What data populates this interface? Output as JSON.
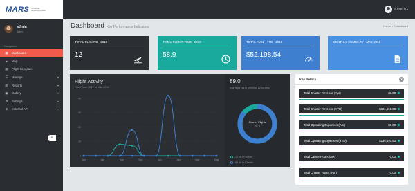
{
  "brand": {
    "logo": "MARS",
    "tagline": "Mil Aircraft Reporting System"
  },
  "user": {
    "name": "admin",
    "role": "John"
  },
  "nav": {
    "heading": "Navigation",
    "items": [
      {
        "label": "Dashboard",
        "icon": "dashboard-icon",
        "active": true,
        "submenu": false
      },
      {
        "label": "Map",
        "icon": "map-icon",
        "active": false,
        "submenu": false
      },
      {
        "label": "Flight Schedule",
        "icon": "calendar-icon",
        "active": false,
        "submenu": false
      },
      {
        "label": "Manage",
        "icon": "list-icon",
        "active": false,
        "submenu": true
      },
      {
        "label": "Reports",
        "icon": "report-icon",
        "active": false,
        "submenu": true
      },
      {
        "label": "Gallery",
        "icon": "gallery-icon",
        "active": false,
        "submenu": true
      },
      {
        "label": "Settings",
        "icon": "gear-icon",
        "active": false,
        "submenu": true
      },
      {
        "label": "External API",
        "icon": "api-icon",
        "active": false,
        "submenu": true
      }
    ],
    "collapse": "«"
  },
  "topbar": {
    "user_label": "NASBLP ▾"
  },
  "page": {
    "title": "Dashboard",
    "subtitle": "Key Performance Indicators"
  },
  "breadcrumb": {
    "home": "Home",
    "sep": "/",
    "current": "Dashboard"
  },
  "stats": [
    {
      "title": "TOTAL FLIGHTS - 2018",
      "value": "12",
      "icon": "airplane-icon",
      "color": "#2b2e33"
    },
    {
      "title": "TOTAL FLIGHT TIME - 2018",
      "value": "58.9",
      "icon": "clock-icon",
      "color": "#1aa99d"
    },
    {
      "title": "TOTAL FUEL - YTD - 2018",
      "value": "$52,198.54",
      "icon": "gauge-icon",
      "color": "#3f7fcf"
    },
    {
      "title": "MONTHLY SUMMARY - May, 2018",
      "value": "",
      "icon": "document-icon",
      "color": "#4a90e2"
    }
  ],
  "activity": {
    "title": "Flight Activity",
    "subtitle": "From June 2017 to May 2018"
  },
  "chart_data": {
    "type": "line",
    "x": [
      "Jun",
      "Jul",
      "Aug",
      "Sep",
      "Oct",
      "Nov",
      "Dec",
      "Jan",
      "Feb",
      "Mar",
      "Apr",
      "May"
    ],
    "x_tick_labels": [
      "Jun",
      "Jan",
      "Mar",
      "Sep",
      "Jan",
      "Jan",
      "Mar",
      "May"
    ],
    "ylim": [
      0,
      40
    ],
    "y_ticks": [
      0,
      10,
      20,
      30,
      40
    ],
    "series": [
      {
        "values": [
          0,
          0,
          0,
          0,
          18,
          0,
          0,
          0,
          0,
          0,
          0,
          0
        ],
        "color": "#3f7fcf"
      },
      {
        "values": [
          0,
          0,
          0,
          8,
          7,
          0,
          0,
          0,
          0,
          0,
          0,
          0
        ],
        "color": "#1aa99d"
      },
      {
        "values": [
          0,
          0,
          0,
          0,
          0,
          0,
          0,
          42,
          0,
          0,
          0,
          0
        ],
        "color": "#3f7fcf"
      }
    ]
  },
  "summary": {
    "value": "89.0",
    "subtitle": "total flight hrs in previous 12 months",
    "donut_label": "Charter Flights",
    "donut_value": "76.9",
    "donut_fraction": 0.86,
    "legend": [
      {
        "label": "12.08 hr Owner",
        "color": "#1aa99d"
      },
      {
        "label": "85.48 hr Charter",
        "color": "#3f7fcf"
      }
    ]
  },
  "metrics": {
    "title": "Key Metrics",
    "rows": [
      {
        "label": "Total Charter Revenue (Apr)",
        "value": "$0.00"
      },
      {
        "label": "Total Charter Revenue (YTD)",
        "value": "$321,651.00"
      },
      {
        "label": "Total Operating Expenses (Apr)",
        "value": "$0.00"
      },
      {
        "label": "Total Operating Expenses (YTD)",
        "value": "$236,440.50"
      },
      {
        "label": "Total Owner Hours (Apr)",
        "value": "0.00"
      },
      {
        "label": "Total Charter Hours (Apr)",
        "value": "0.00"
      }
    ]
  }
}
